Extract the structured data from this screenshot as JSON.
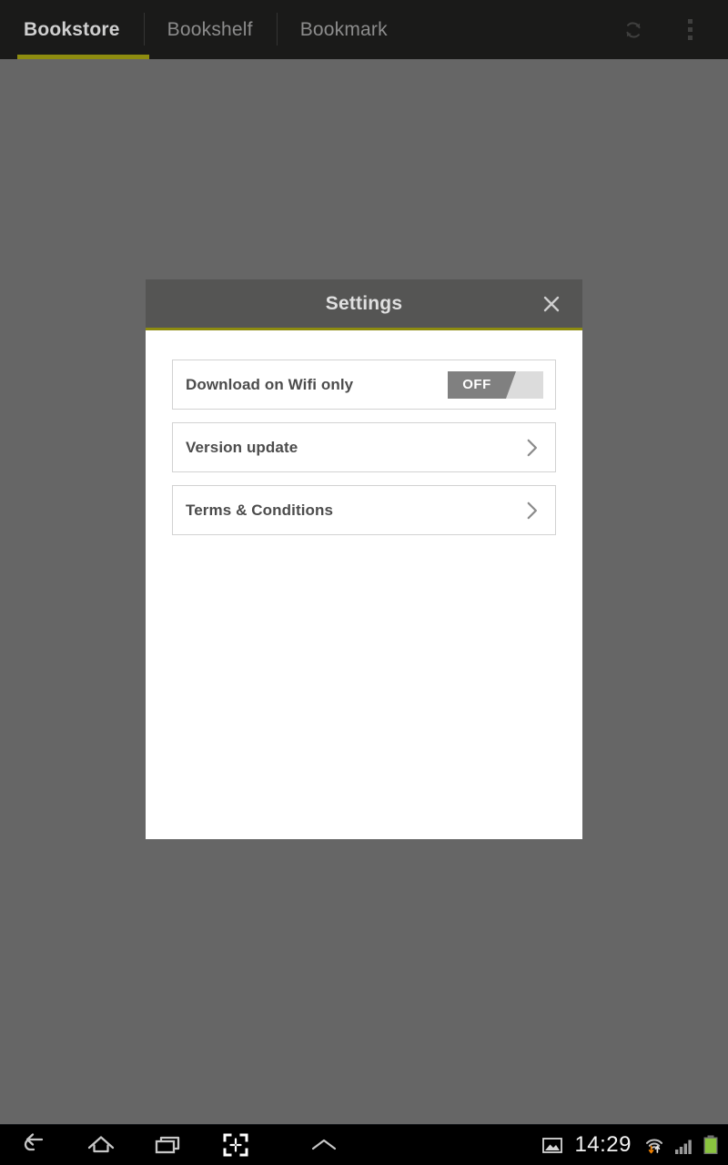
{
  "app_bar": {
    "tabs": [
      {
        "label": "Bookstore",
        "active": true
      },
      {
        "label": "Bookshelf",
        "active": false
      },
      {
        "label": "Bookmark",
        "active": false
      }
    ],
    "actions": [
      {
        "name": "refresh-icon",
        "label": "Refresh"
      },
      {
        "name": "overflow-menu-icon",
        "label": "More options"
      }
    ],
    "accent_color": "#8e8c10",
    "background_color": "#1a1a19"
  },
  "scrim": {
    "color": "#666666"
  },
  "dialog": {
    "title": "Settings",
    "close_label": "Close",
    "header_color": "#555554",
    "accent_color": "#8e8c10",
    "background_color": "#ffffff",
    "rows": [
      {
        "label": "Download on Wifi only",
        "control": "toggle",
        "value": "OFF",
        "state": "off"
      },
      {
        "label": "Version update",
        "control": "chevron",
        "value": ""
      },
      {
        "label": "Terms & Conditions",
        "control": "chevron",
        "value": ""
      }
    ]
  },
  "nav_bar": {
    "buttons": [
      {
        "name": "back-icon",
        "label": "Back"
      },
      {
        "name": "home-icon",
        "label": "Home"
      },
      {
        "name": "recents-icon",
        "label": "Recent apps"
      },
      {
        "name": "screenshot-icon",
        "label": "Screenshot"
      },
      {
        "name": "expand-up-icon",
        "label": "Show notifications"
      }
    ],
    "status": {
      "screenshot_notification": "image-icon",
      "time": "14:29",
      "wifi": "wifi-icon",
      "signal": "cellular-signal-icon",
      "battery": "battery-icon",
      "battery_color": "#8ac43f"
    }
  }
}
